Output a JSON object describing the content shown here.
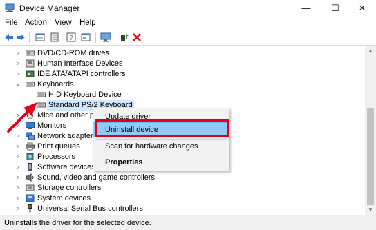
{
  "window": {
    "title": "Device Manager",
    "minimize": "—",
    "maximize": "☐",
    "close": "✕"
  },
  "menu": [
    "File",
    "Action",
    "View",
    "Help"
  ],
  "toolbar_icons": [
    "back-arrow-icon",
    "forward-arrow-icon",
    "properties-grid-icon",
    "help-book-icon",
    "properties-sheet-icon",
    "driver-update-icon",
    "scan-monitor-icon",
    "add-driver-icon",
    "remove-x-icon"
  ],
  "tree": [
    {
      "label": "DVD/CD-ROM drives",
      "expander": ">",
      "icon": "dvd-drive-icon"
    },
    {
      "label": "Human Interface Devices",
      "expander": ">",
      "icon": "hid-icon"
    },
    {
      "label": "IDE ATA/ATAPI controllers",
      "expander": ">",
      "icon": "ide-controller-icon"
    },
    {
      "label": "Keyboards",
      "expander": "v",
      "icon": "keyboard-icon"
    },
    {
      "label": "HID Keyboard Device",
      "expander": "",
      "icon": "keyboard-icon",
      "child": true
    },
    {
      "label": "Standard PS/2 Keyboard",
      "expander": "",
      "icon": "keyboard-icon",
      "child": true,
      "selected": true
    },
    {
      "label": "Mice and other poi",
      "expander": ">",
      "icon": "mouse-icon"
    },
    {
      "label": "Monitors",
      "expander": ">",
      "icon": "monitor-icon"
    },
    {
      "label": "Network adapters",
      "expander": ">",
      "icon": "network-icon"
    },
    {
      "label": "Print queues",
      "expander": ">",
      "icon": "printer-icon"
    },
    {
      "label": "Processors",
      "expander": ">",
      "icon": "processor-icon"
    },
    {
      "label": "Software devices",
      "expander": ">",
      "icon": "software-device-icon"
    },
    {
      "label": "Sound, video and game controllers",
      "expander": ">",
      "icon": "sound-icon"
    },
    {
      "label": "Storage controllers",
      "expander": ">",
      "icon": "storage-icon"
    },
    {
      "label": "System devices",
      "expander": ">",
      "icon": "system-device-icon"
    },
    {
      "label": "Universal Serial Bus controllers",
      "expander": ">",
      "icon": "usb-icon"
    }
  ],
  "context_menu": {
    "update_driver": "Update driver",
    "uninstall_device": "Uninstall device",
    "scan": "Scan for hardware changes",
    "properties": "Properties"
  },
  "status": "Uninstalls the driver for the selected device.",
  "colors": {
    "highlight_box": "#e3001b",
    "arrow": "#e3001b",
    "menu_highlight": "#91c9f7",
    "selection": "#cde8ff"
  }
}
